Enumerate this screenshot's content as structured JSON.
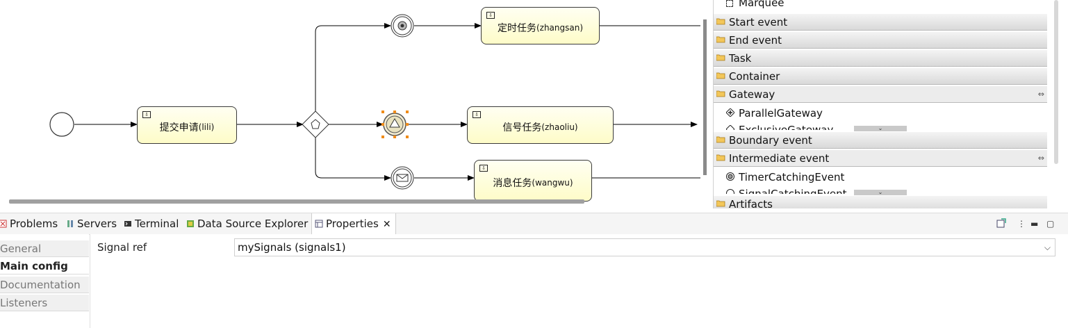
{
  "diagram": {
    "tasks": [
      {
        "title": "提交申请",
        "user": "(lili)"
      },
      {
        "title": "定时任务",
        "user": "(zhangsan)"
      },
      {
        "title": "信号任务",
        "user": "(zhaoliu)"
      },
      {
        "title": "消息任务",
        "user": "(wangwu)"
      }
    ]
  },
  "palette": {
    "marquee": "Marquee",
    "drawers": {
      "start_event": "Start event",
      "end_event": "End event",
      "task": "Task",
      "container": "Container",
      "gateway": "Gateway",
      "boundary_event": "Boundary event",
      "intermediate_event": "Intermediate event",
      "artifacts": "Artifacts"
    },
    "gateway_items": [
      "ParallelGateway",
      "ExclusiveGateway"
    ],
    "intermediate_items": [
      "TimerCatchingEvent",
      "SignalCatchingEvent"
    ]
  },
  "views": {
    "tabs": [
      "Problems",
      "Servers",
      "Terminal",
      "Data Source Explorer",
      "Properties"
    ]
  },
  "properties": {
    "tabs": [
      "General",
      "Main config",
      "Documentation",
      "Listeners"
    ],
    "signal_ref_label": "Signal ref",
    "signal_ref_value": "mySignals (signals1)"
  },
  "colors": {
    "selection": "#f08c1a",
    "task_fill": "#fefcc8"
  }
}
